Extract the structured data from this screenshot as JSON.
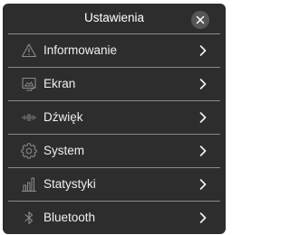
{
  "dialog": {
    "title": "Ustawienia",
    "close_icon": "close-icon"
  },
  "menu": {
    "items": [
      {
        "label": "Informowanie",
        "icon": "warning-icon"
      },
      {
        "label": "Ekran",
        "icon": "screen-icon"
      },
      {
        "label": "Dźwięk",
        "icon": "sound-icon"
      },
      {
        "label": "System",
        "icon": "gear-icon"
      },
      {
        "label": "Statystyki",
        "icon": "bar-chart-icon"
      },
      {
        "label": "Bluetooth",
        "icon": "bluetooth-icon"
      }
    ]
  },
  "colors": {
    "background": "#2d2d2d",
    "text": "#f0f0f0",
    "divider": "#8a8a8a",
    "icon": "#8c8c8c"
  }
}
